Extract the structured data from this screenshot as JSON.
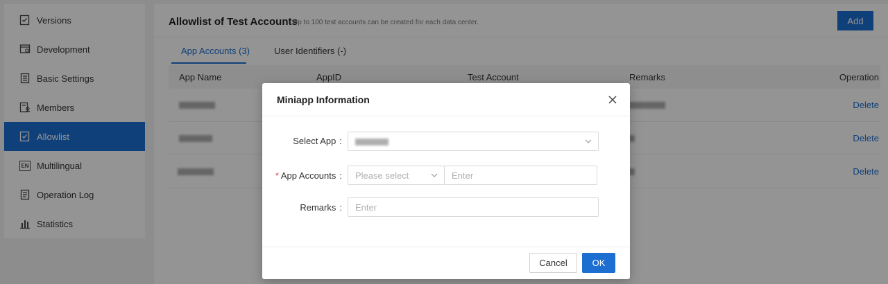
{
  "sidebar": {
    "items": [
      {
        "label": "Versions",
        "icon": "versions-icon"
      },
      {
        "label": "Development",
        "icon": "development-icon"
      },
      {
        "label": "Basic Settings",
        "icon": "basic-settings-icon"
      },
      {
        "label": "Members",
        "icon": "members-icon"
      },
      {
        "label": "Allowlist",
        "icon": "allowlist-icon",
        "active": true
      },
      {
        "label": "Multilingual",
        "icon": "multilingual-icon"
      },
      {
        "label": "Operation Log",
        "icon": "operation-log-icon"
      },
      {
        "label": "Statistics",
        "icon": "statistics-icon"
      }
    ],
    "multilingual_glyph": "EN"
  },
  "header": {
    "title": "Allowlist of Test Accounts",
    "hint": "Up to 100 test accounts can be created for each data center.",
    "add_label": "Add"
  },
  "tabs": [
    {
      "label": "App Accounts (3)",
      "active": true
    },
    {
      "label": "User Identifiers (-)"
    }
  ],
  "table": {
    "columns": [
      "App Name",
      "AppID",
      "Test Account",
      "Remarks",
      "Operation"
    ],
    "rows": [
      {
        "operation": "Delete"
      },
      {
        "operation": "Delete"
      },
      {
        "operation": "Delete"
      }
    ]
  },
  "modal": {
    "title": "Miniapp Information",
    "select_app_label": "Select App",
    "app_accounts_label": "App Accounts",
    "required_mark": "*",
    "app_accounts_select_placeholder": "Please select",
    "app_accounts_input_placeholder": "Enter",
    "remarks_label": "Remarks",
    "remarks_placeholder": "Enter",
    "label_colon": ":",
    "cancel_label": "Cancel",
    "ok_label": "OK"
  },
  "colors": {
    "accent": "#1c6ed1",
    "required": "#e34b4b"
  }
}
